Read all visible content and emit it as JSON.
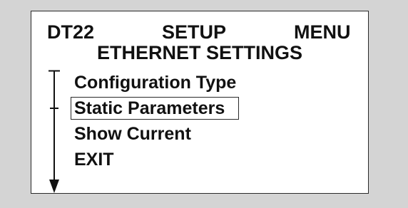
{
  "header": {
    "left": "DT22",
    "center": "SETUP",
    "right": "MENU"
  },
  "subtitle": "ETHERNET SETTINGS",
  "menu": {
    "items": [
      {
        "label": "Configuration Type"
      },
      {
        "label": "Static Parameters"
      },
      {
        "label": "Show Current"
      },
      {
        "label": "EXIT"
      }
    ],
    "selected_label": "Static Parameters"
  },
  "scroll": {
    "direction": "down",
    "icon": "scroll-down-arrow-icon"
  },
  "colors": {
    "background": "#d4d4d4",
    "screen": "#ffffff",
    "text": "#111111",
    "border": "#2a2a2a"
  }
}
